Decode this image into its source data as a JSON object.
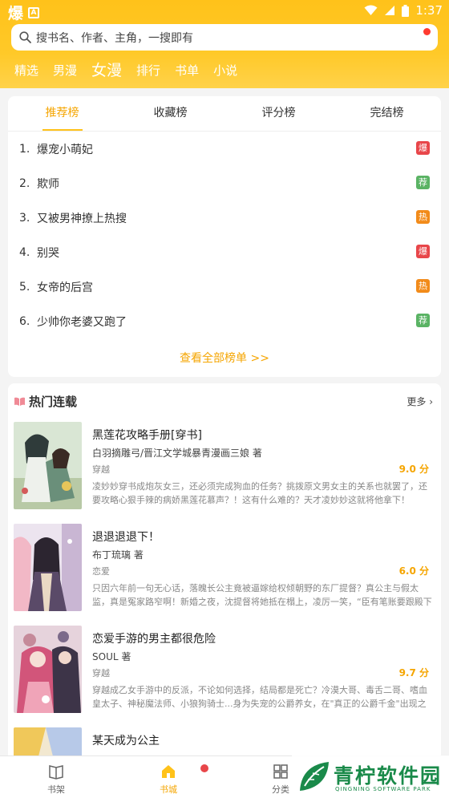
{
  "status_bar": {
    "app_icon": "爆",
    "badge": "A",
    "time": "1:37"
  },
  "search": {
    "placeholder": "搜书名、作者、主角，一搜即有"
  },
  "top_nav": [
    {
      "label": "精选"
    },
    {
      "label": "男漫"
    },
    {
      "label": "女漫"
    },
    {
      "label": "排行"
    },
    {
      "label": "书单"
    },
    {
      "label": "小说"
    }
  ],
  "ranking": {
    "tabs": [
      {
        "label": "推荐榜"
      },
      {
        "label": "收藏榜"
      },
      {
        "label": "评分榜"
      },
      {
        "label": "完结榜"
      }
    ],
    "items": [
      {
        "rank": "1.",
        "title": "爆宠小萌妃",
        "tag": "爆"
      },
      {
        "rank": "2.",
        "title": "欺师",
        "tag": "荐"
      },
      {
        "rank": "3.",
        "title": "又被男神撩上热搜",
        "tag": "热"
      },
      {
        "rank": "4.",
        "title": "别哭",
        "tag": "爆"
      },
      {
        "rank": "5.",
        "title": "女帝的后宫",
        "tag": "热"
      },
      {
        "rank": "6.",
        "title": "少帅你老婆又跑了",
        "tag": "荐"
      }
    ],
    "more_label": "查看全部榜单 >>"
  },
  "hot": {
    "title": "热门连载",
    "more_label": "更多",
    "books": [
      {
        "title": "黑莲花攻略手册[穿书]",
        "author": "白羽摘雕弓/晋江文学城暴青漫画三娘 著",
        "genre": "穿越",
        "score": "9.0 分",
        "desc": "凌妙妙穿书成炮灰女三，还必须完成狗血的任务？挑拨原文男女主的关系也就罢了，还要攻略心狠手辣的病娇黑莲花慕声？！这有什么难的？天才凌妙妙这就将他拿下！"
      },
      {
        "title": "退退退退下！",
        "author": "布丁琉璃 著",
        "genre": "恋爱",
        "score": "6.0 分",
        "desc": "只因六年前一句无心话，落魄长公主竟被逼嫁给权倾朝野的东厂提督？真公主与假太监，真是冤家路窄啊！新婚之夜，沈提督将她抵在榻上，凌厉一笑，“臣有笔账要跟殿下算。”"
      },
      {
        "title": "恋爱手游的男主都很危险",
        "author": "SOUL 著",
        "genre": "穿越",
        "score": "9.7 分",
        "desc": "穿越成乙女手游中的反派，不论如何选择，结局都是死亡？冷漠大哥、毒舌二哥、嗜血皇太子、神秘魔法师、小狼狗骑士...身为失宠的公爵养女，在\"真正的公爵千金\"出现之前..."
      },
      {
        "title": "某天成为公主",
        "author": "",
        "genre": "",
        "score": "",
        "desc": ""
      }
    ]
  },
  "tabbar": [
    {
      "label": "书架"
    },
    {
      "label": "书城"
    },
    {
      "label": "分类"
    }
  ],
  "watermark": {
    "text": "青柠软件园",
    "sub": "QINGNING SOFTWARE PARK"
  },
  "colors": {
    "accent": "#ffc21a",
    "accent_text": "#f5a500",
    "tag_red": "#e8464a",
    "tag_green": "#5ab364",
    "tag_orange": "#f28b1a"
  }
}
